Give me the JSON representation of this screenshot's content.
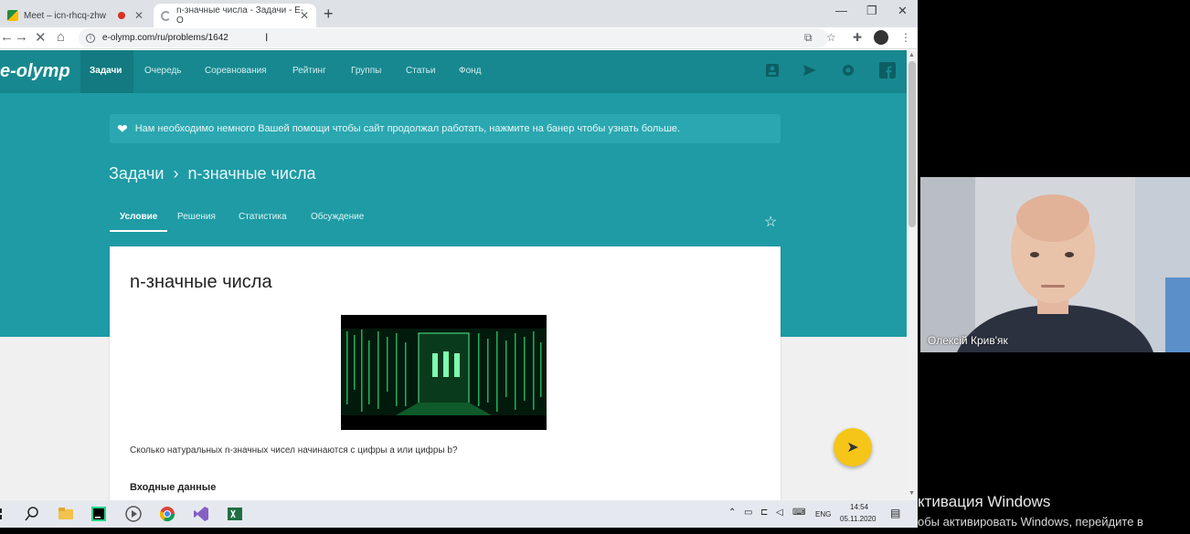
{
  "browser": {
    "tabs": [
      {
        "title": "Meet – icn-rhcq-zhw"
      },
      {
        "title": "n-значные числа - Задачи - E-O"
      }
    ],
    "url": "e-olymp.com/ru/problems/1642",
    "new_tab": "+",
    "controls": {
      "minimize": "—",
      "maximize": "❐",
      "close": "✕"
    }
  },
  "site": {
    "logo": "e-olymp",
    "nav": [
      "Задачи",
      "Очередь",
      "Соревнования",
      "Рейтинг",
      "Группы",
      "Статьи",
      "Фонд"
    ],
    "banner": "Нам необходимо немного Вашей помощи чтобы сайт продолжал работать, нажмите на банер чтобы узнать больше.",
    "breadcrumb": {
      "root": "Задачи",
      "separator": "›",
      "current": "n-значные числа"
    },
    "subtabs": [
      "Условие",
      "Решения",
      "Статистика",
      "Обсуждение"
    ],
    "problem": {
      "title": "n-значные числа",
      "statement": "Сколько натуральных n-значных чисел начинаются с цифры a или цифры b?",
      "input_heading": "Входные данные"
    }
  },
  "video": {
    "participant": "Олексій Крив'як"
  },
  "taskbar": {
    "lang": "ENG",
    "time": "14:54",
    "date": "05.11.2020"
  },
  "watermark": {
    "line1": "ктивация Windows",
    "line2": "обы активировать Windows, перейдите в"
  },
  "colors": {
    "teal": "#1e9ba5",
    "nav": "#17888f",
    "fab": "#f5c518"
  }
}
